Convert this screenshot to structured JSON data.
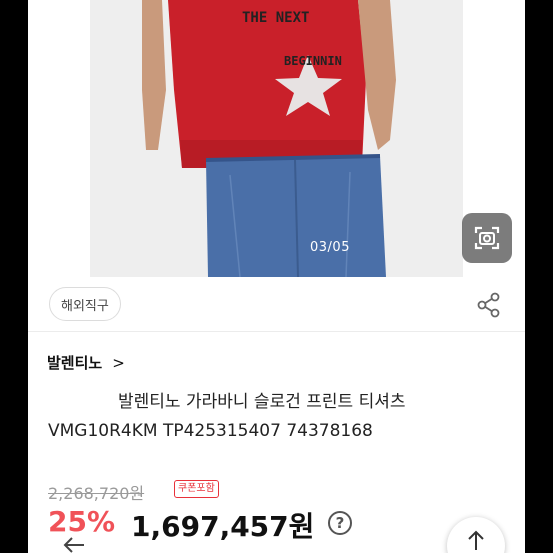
{
  "gallery": {
    "counter": "03/05",
    "print_line_1": "THE NEXT",
    "print_line_2": "BEGINNIN"
  },
  "badges": {
    "overseas": "해외직구"
  },
  "brand": {
    "name": "발렌티노",
    "chevron": ">"
  },
  "product": {
    "title": "발렌티노 가라바니 슬로건 프린트 티셔츠 VMG10R4KM TP425315407 74378168"
  },
  "price": {
    "original": "2,268,720원",
    "coupon": "쿠폰포함",
    "discount": "25%",
    "sale": "1,697,457원",
    "info": "?"
  },
  "icons": {
    "lens": "camera-lens-icon",
    "share": "share-icon",
    "back": "back-arrow-icon",
    "scroll_top": "arrow-up-icon"
  },
  "colors": {
    "shirt_red": "#c9202a",
    "denim": "#4a6fa8",
    "discount_red": "#f05258",
    "coupon_red": "#e8313a"
  }
}
